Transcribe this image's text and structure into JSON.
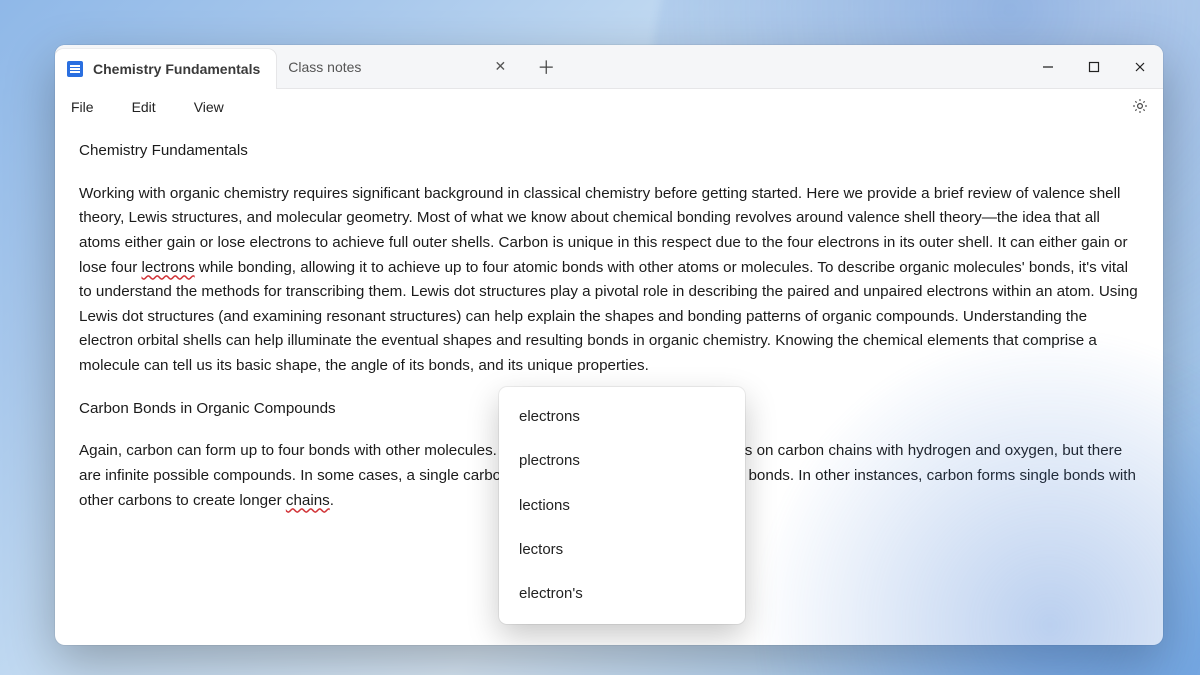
{
  "tabs": {
    "active": {
      "title": "Chemistry Fundamentals"
    },
    "inactive": {
      "title": "Class notes"
    }
  },
  "menubar": {
    "file": "File",
    "edit": "Edit",
    "view": "View"
  },
  "document": {
    "title": "Chemistry Fundamentals",
    "p1a": "Working with organic chemistry requires significant background in classical chemistry before getting started. Here we provide a brief review of valence shell theory, Lewis structures, and molecular geometry. Most of what we know about chemical bonding revolves around valence shell theory—the idea that all atoms either gain or lose electrons to achieve full outer shells. Carbon is unique in this respect due to the four electrons in its outer shell. It can either gain or lose four ",
    "p1_misspelled": "lectrons",
    "p1b": " while bonding, allowing it to achieve up to four atomic bonds with other atoms or molecules. To describe organic molecules' bonds, it's vital to understand the methods for transcribing them. Lewis dot structures play a pivotal role in describing the paired and unpaired electrons within an atom. Using Lewis dot structures (and examining resonant structures) can help explain the shapes and bonding patterns of organic compounds. Understanding the electron orbital shells can help illuminate the eventual shapes and resulting bonds in organic chemistry. Knowing the chemical elements that comprise a molecule can tell us its basic shape, the angle of its bonds, and its unique properties.",
    "subhead": "Carbon Bonds in Organic Compounds",
    "p2a": "Again, carbon can form up to four bonds with other molecules. In organic chemistry, we mainly focus on carbon chains with hydrogen and oxygen, but there are infinite possible compounds. In some cases, a single carbon bonds with four hydrogen in single bonds. In other instances, carbon forms single bonds with other carbons to create longer ",
    "p2_misspelled": "chains",
    "p2b": "."
  },
  "spellcheck": {
    "suggestions": [
      "electrons",
      "plectrons",
      "lections",
      "lectors",
      "electron's"
    ]
  }
}
